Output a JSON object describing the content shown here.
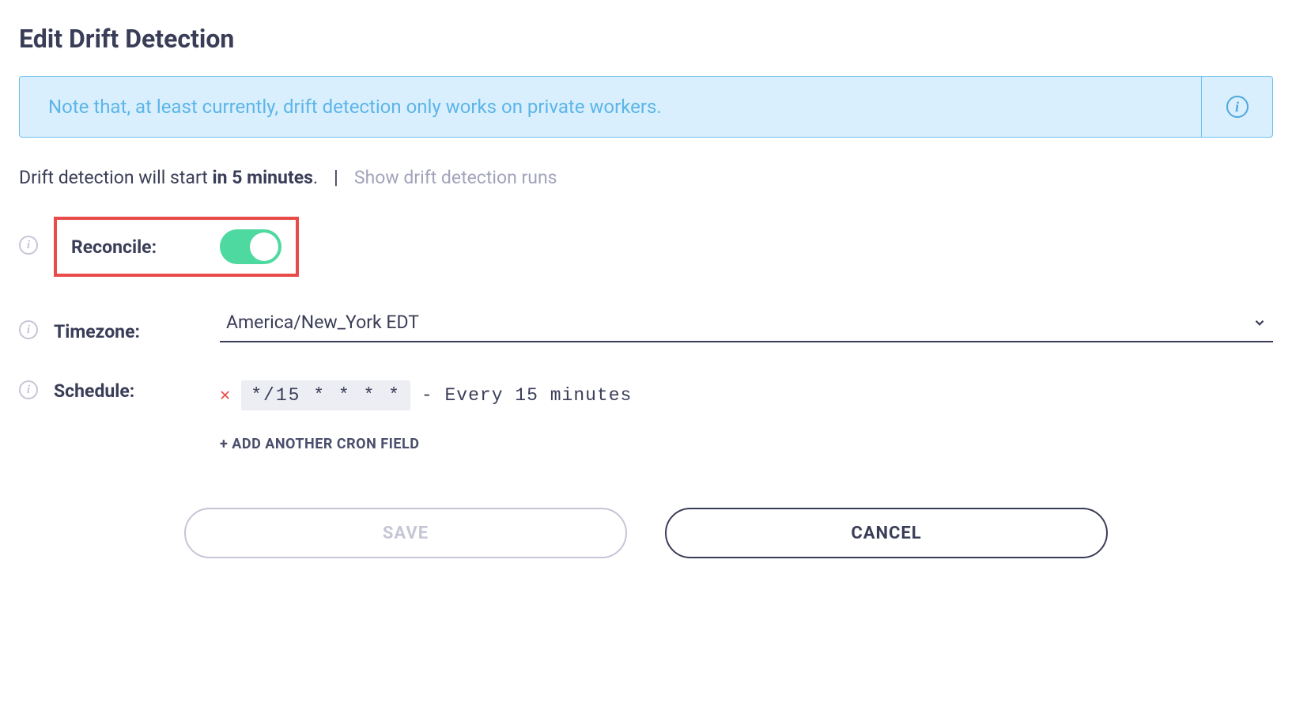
{
  "title": "Edit Drift Detection",
  "banner": {
    "text": "Note that, at least currently, drift detection only works on private workers."
  },
  "status": {
    "prefix": "Drift detection will start ",
    "bold": "in 5 minutes",
    "suffix": ".",
    "showRunsLabel": "Show drift detection runs"
  },
  "reconcile": {
    "label": "Reconcile:",
    "enabled": true
  },
  "timezone": {
    "label": "Timezone:",
    "value": "America/New_York EDT"
  },
  "schedule": {
    "label": "Schedule:",
    "cron": "*/15 * * * *",
    "description": "- Every 15 minutes",
    "addLabel": "+ ADD ANOTHER CRON FIELD"
  },
  "buttons": {
    "save": "SAVE",
    "cancel": "CANCEL"
  }
}
